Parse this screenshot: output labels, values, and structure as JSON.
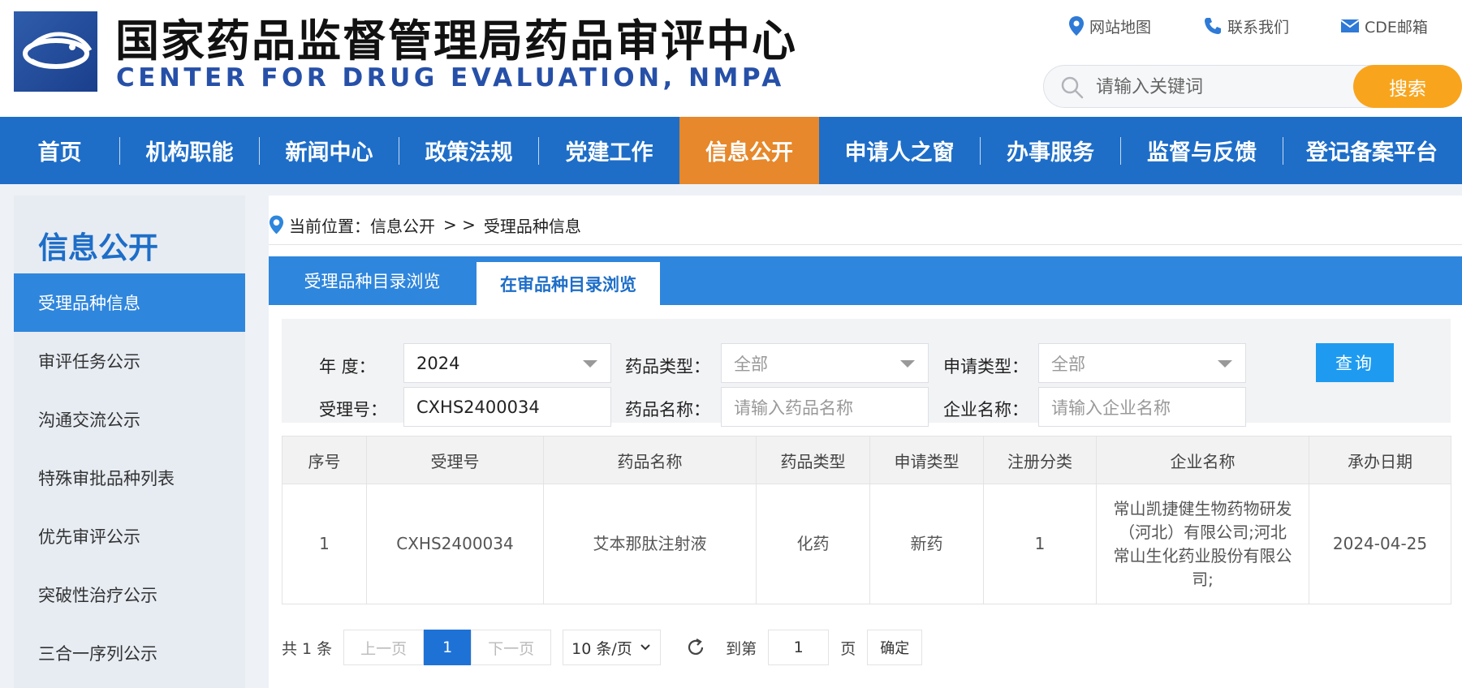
{
  "header": {
    "title_cn": "国家药品监督管理局药品审评中心",
    "title_en": "CENTER FOR DRUG EVALUATION, NMPA",
    "links": [
      {
        "label": "网站地图",
        "icon": "map-pin-icon"
      },
      {
        "label": "联系我们",
        "icon": "phone-icon"
      },
      {
        "label": "CDE邮箱",
        "icon": "mail-icon"
      }
    ],
    "search": {
      "placeholder": "请输入关键词",
      "button": "搜索"
    }
  },
  "nav": {
    "items": [
      "首页",
      "机构职能",
      "新闻中心",
      "政策法规",
      "党建工作",
      "信息公开",
      "申请人之窗",
      "办事服务",
      "监督与反馈",
      "登记备案平台"
    ],
    "active": "信息公开"
  },
  "sidebar": {
    "title": "信息公开",
    "items": [
      "受理品种信息",
      "审评任务公示",
      "沟通交流公示",
      "特殊审批品种列表",
      "优先审评公示",
      "突破性治疗公示",
      "三合一序列公示"
    ]
  },
  "breadcrumb": {
    "prefix": "当前位置：",
    "section": "信息公开",
    "sep": "> >",
    "current": "受理品种信息"
  },
  "tabs": [
    "受理品种目录浏览",
    "在审品种目录浏览"
  ],
  "filters": {
    "year_label": "年   度：",
    "year_value": "2024",
    "drug_type_label": "药品类型：",
    "drug_type_value": "全部",
    "apply_type_label": "申请类型：",
    "apply_type_value": "全部",
    "accept_no_label": "受理号：",
    "accept_no_value": "CXHS2400034",
    "drug_name_label": "药品名称：",
    "drug_name_placeholder": "请输入药品名称",
    "company_label": "企业名称：",
    "company_placeholder": "请输入企业名称",
    "query_button": "查询"
  },
  "table": {
    "headers": [
      "序号",
      "受理号",
      "药品名称",
      "药品类型",
      "申请类型",
      "注册分类",
      "企业名称",
      "承办日期"
    ],
    "rows": [
      [
        "1",
        "CXHS2400034",
        "艾本那肽注射液",
        "化药",
        "新药",
        "1",
        "常山凯捷健生物药物研发（河北）有限公司;河北常山生化药业股份有限公司;",
        "2024-04-25"
      ]
    ]
  },
  "pagination": {
    "total": "共 1 条",
    "prev": "上一页",
    "page": "1",
    "next": "下一页",
    "page_size": "10 条/页",
    "goto": "到第",
    "goto_value": "1",
    "unit": "页",
    "confirm": "确定"
  },
  "colors": {
    "brand_blue": "#1e6ec8",
    "active_orange": "#e6882b",
    "search_orange": "#f8a51d"
  }
}
